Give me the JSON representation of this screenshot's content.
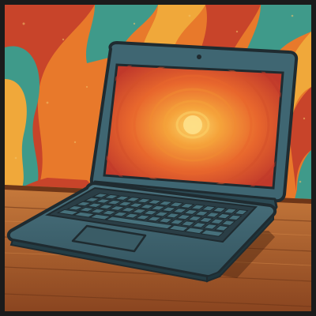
{
  "scene": {
    "subject": "laptop-illustration",
    "style": "retro-psychedelic"
  },
  "colors": {
    "frame": "#1b1b1b",
    "wall_orange": "#e8792b",
    "wall_red": "#c8442a",
    "wall_yellow": "#f0a83a",
    "wall_teal": "#3f9a8a",
    "wall_cream": "#f2c36b",
    "desk_light": "#b86a33",
    "desk_dark": "#7a3d1d",
    "laptop_body": "#3f6672",
    "laptop_body_dark": "#2c4a54",
    "laptop_outline": "#1f2b30",
    "keys": "#2a3e46",
    "screen_outer": "#c0392b",
    "screen_mid": "#e8672d",
    "screen_inner": "#f5a33b",
    "screen_center": "#fbd36a",
    "camera": "#1f2b30"
  },
  "icons": {
    "camera": "webcam-dot",
    "trackpad": "trackpad-rect"
  }
}
